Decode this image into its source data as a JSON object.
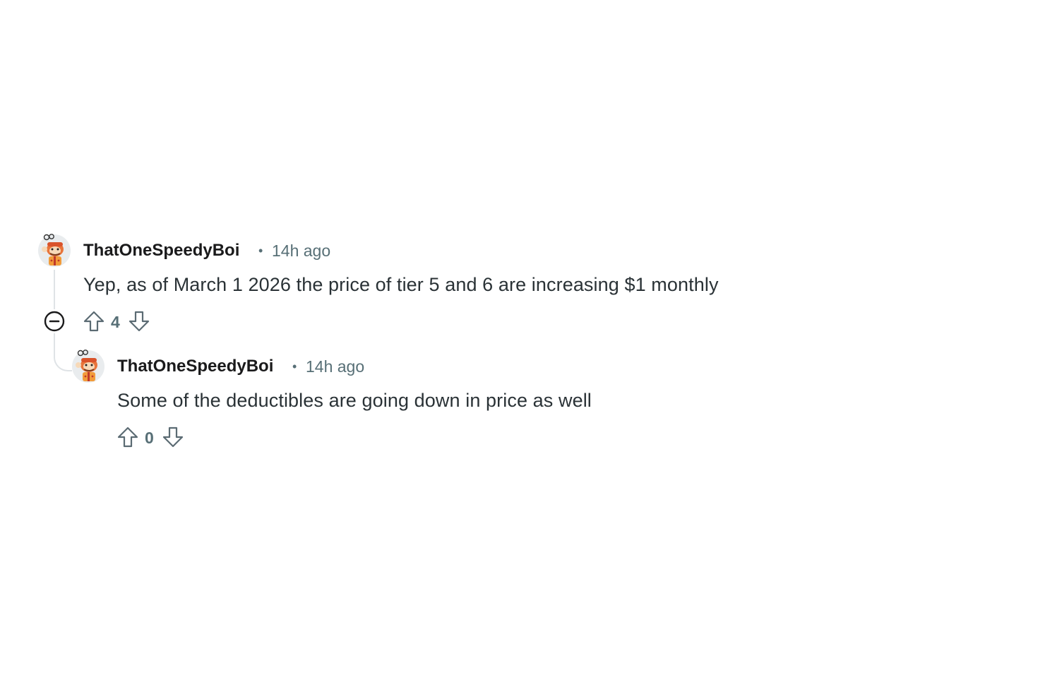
{
  "comments": [
    {
      "username": "ThatOneSpeedyBoi",
      "separator": "•",
      "timestamp": "14h ago",
      "body": "Yep, as of March 1 2026 the price of tier 5 and 6 are increasing $1 monthly",
      "score": "4",
      "collapse_icon": "collapse-minus-icon"
    },
    {
      "username": "ThatOneSpeedyBoi",
      "separator": "•",
      "timestamp": "14h ago",
      "body": "Some of the deductibles are going down in price as well",
      "score": "0"
    }
  ],
  "colors": {
    "meta": "#576f76",
    "thread_line": "#dfe3e6",
    "text": "#2a3236",
    "username": "#1a1a1b"
  }
}
